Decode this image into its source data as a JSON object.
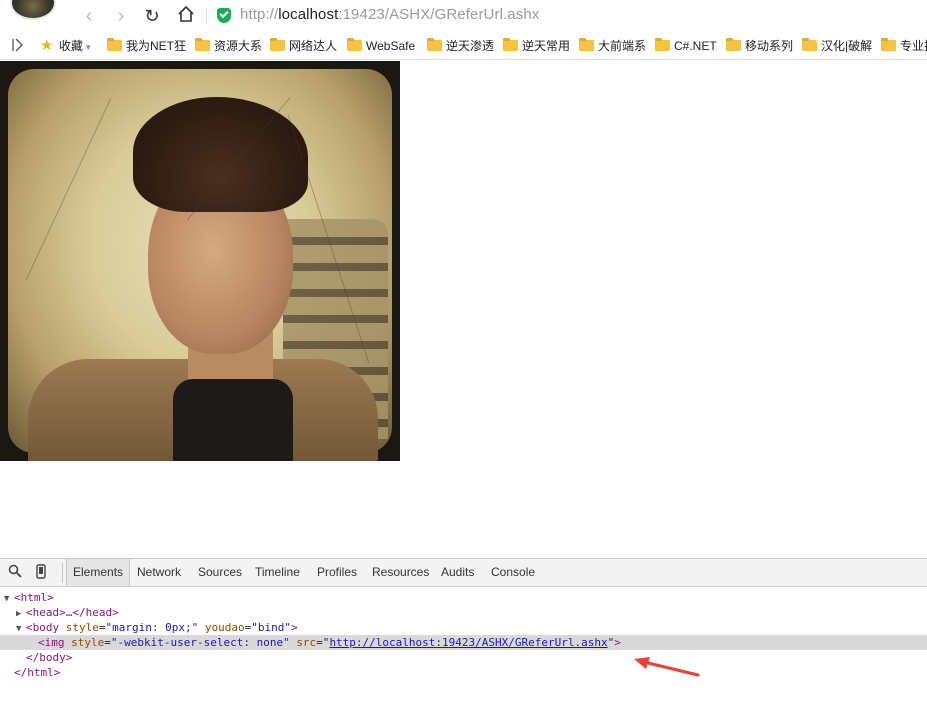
{
  "address_bar": {
    "url_scheme": "http://",
    "url_host": "localhost",
    "url_rest": ":19423/ASHX/GReferUrl.ashx"
  },
  "bookmarks": {
    "favorites_label": "收藏",
    "items": [
      {
        "label": "我为NET狂"
      },
      {
        "label": "资源大系"
      },
      {
        "label": "网络达人"
      },
      {
        "label": "WebSafe"
      },
      {
        "label": "逆天渗透"
      },
      {
        "label": "逆天常用"
      },
      {
        "label": "大前端系"
      },
      {
        "label": "C#.NET"
      },
      {
        "label": "移动系列"
      },
      {
        "label": "汉化|破解"
      },
      {
        "label": "专业挂"
      }
    ]
  },
  "devtools": {
    "tabs": [
      {
        "label": "Elements"
      },
      {
        "label": "Network"
      },
      {
        "label": "Sources"
      },
      {
        "label": "Timeline"
      },
      {
        "label": "Profiles"
      },
      {
        "label": "Resources"
      },
      {
        "label": "Audits"
      },
      {
        "label": "Console"
      }
    ],
    "dom": {
      "html_open": "<html>",
      "head": "<head>…</head>",
      "body_open_tag": "<body",
      "body_attr1_name": "style",
      "body_attr1_val": "\"margin: 0px;\"",
      "body_attr2_name": "youdao",
      "body_attr2_val": "\"bind\"",
      "img_open_tag": "<img",
      "img_attr1_name": "style",
      "img_attr1_val": "\"-webkit-user-select: none\"",
      "img_attr2_name": "src",
      "img_src_url": "http://localhost:19423/ASHX/GReferUrl.ashx",
      "body_close": "</body>",
      "html_close": "</html>"
    }
  },
  "colors": {
    "highlight_row": "#d9d9d9",
    "annotation_arrow": "#e8413b",
    "shield_green": "#1faa59"
  }
}
